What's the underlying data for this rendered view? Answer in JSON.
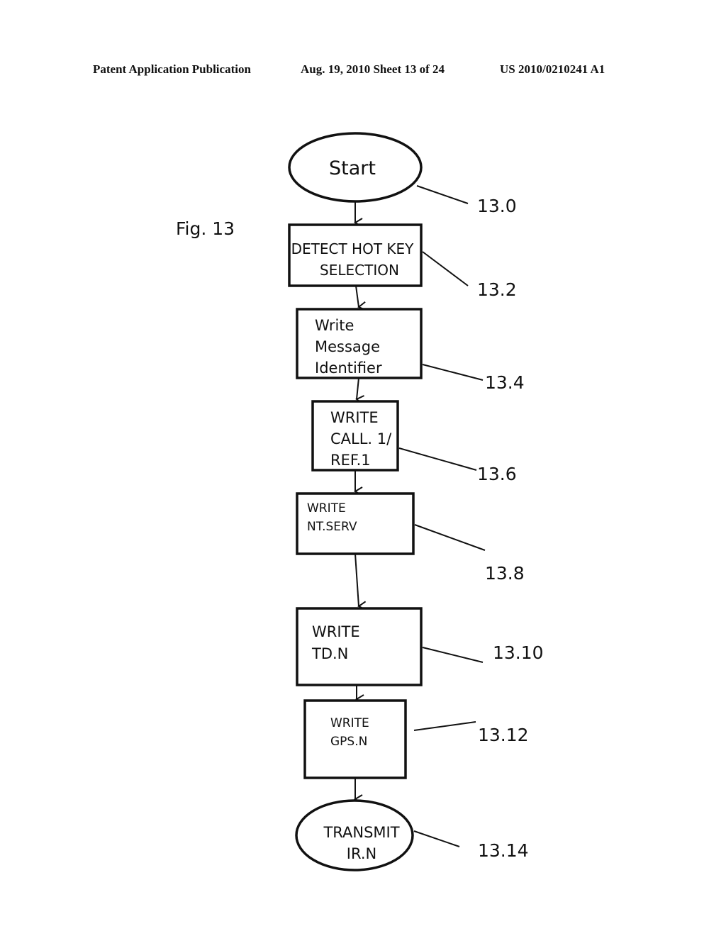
{
  "header": {
    "publication": "Patent Application Publication",
    "date_sheet": "Aug. 19, 2010  Sheet 13 of 24",
    "patent_number": "US 2010/0210241 A1"
  },
  "figure": {
    "label": "Fig. 13"
  },
  "nodes": [
    {
      "id": "start",
      "shape": "ellipse",
      "lines": [
        "Start"
      ],
      "ref": "13.0"
    },
    {
      "id": "detect",
      "shape": "rect",
      "lines": [
        "DETECT HOT KEY",
        "SELECTION"
      ],
      "ref": "13.2"
    },
    {
      "id": "write-msg",
      "shape": "rect",
      "lines": [
        "Write",
        "Message",
        "Identifier"
      ],
      "ref": "13.4"
    },
    {
      "id": "write-call",
      "shape": "rect",
      "lines": [
        "WRITE",
        "CALL. 1/",
        "REF.1"
      ],
      "ref": "13.6"
    },
    {
      "id": "write-ntserv",
      "shape": "rect",
      "lines": [
        "WRITE",
        "NT.SERV"
      ],
      "ref": "13.8"
    },
    {
      "id": "write-tdn",
      "shape": "rect",
      "lines": [
        "WRITE",
        "TD.N"
      ],
      "ref": "13.10"
    },
    {
      "id": "write-gpsn",
      "shape": "rect",
      "lines": [
        "WRITE",
        "GPS.N"
      ],
      "ref": "13.12"
    },
    {
      "id": "transmit",
      "shape": "ellipse",
      "lines": [
        "TRANSMIT",
        "IR.N"
      ],
      "ref": "13.14"
    }
  ]
}
